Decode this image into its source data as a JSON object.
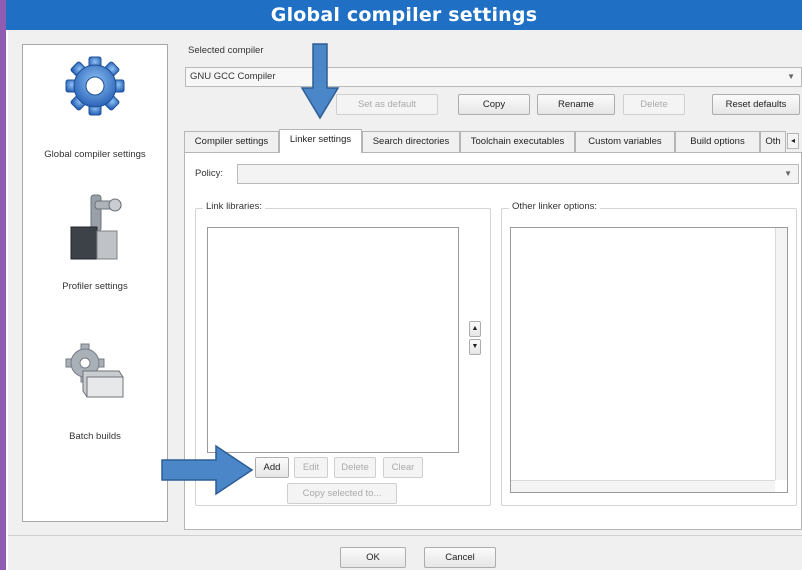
{
  "window": {
    "title": "Global compiler settings",
    "accent": "#1f6fc4",
    "frame_color": "#8e5cb0"
  },
  "sidebar": {
    "items": [
      {
        "label": "Global compiler settings",
        "icon": "gear-icon"
      },
      {
        "label": "Profiler settings",
        "icon": "profiler-icon"
      },
      {
        "label": "Batch builds",
        "icon": "batch-builds-icon"
      }
    ]
  },
  "compiler": {
    "label": "Selected compiler",
    "value": "GNU GCC Compiler"
  },
  "compiler_buttons": {
    "set_default": "Set as default",
    "copy": "Copy",
    "rename": "Rename",
    "delete": "Delete",
    "reset": "Reset defaults"
  },
  "tabs": [
    {
      "label": "Compiler settings"
    },
    {
      "label": "Linker settings",
      "active": true
    },
    {
      "label": "Search directories"
    },
    {
      "label": "Toolchain executables"
    },
    {
      "label": "Custom variables"
    },
    {
      "label": "Build options"
    },
    {
      "label": "Oth"
    }
  ],
  "policy": {
    "label": "Policy:",
    "value": ""
  },
  "link_libraries": {
    "title": "Link libraries:",
    "buttons": {
      "add": "Add",
      "edit": "Edit",
      "delete": "Delete",
      "clear": "Clear",
      "copy_selected": "Copy selected to..."
    }
  },
  "other_options": {
    "title": "Other linker options:"
  },
  "dialog_buttons": {
    "ok": "OK",
    "cancel": "Cancel"
  },
  "annotation_color": "#4a86c8"
}
